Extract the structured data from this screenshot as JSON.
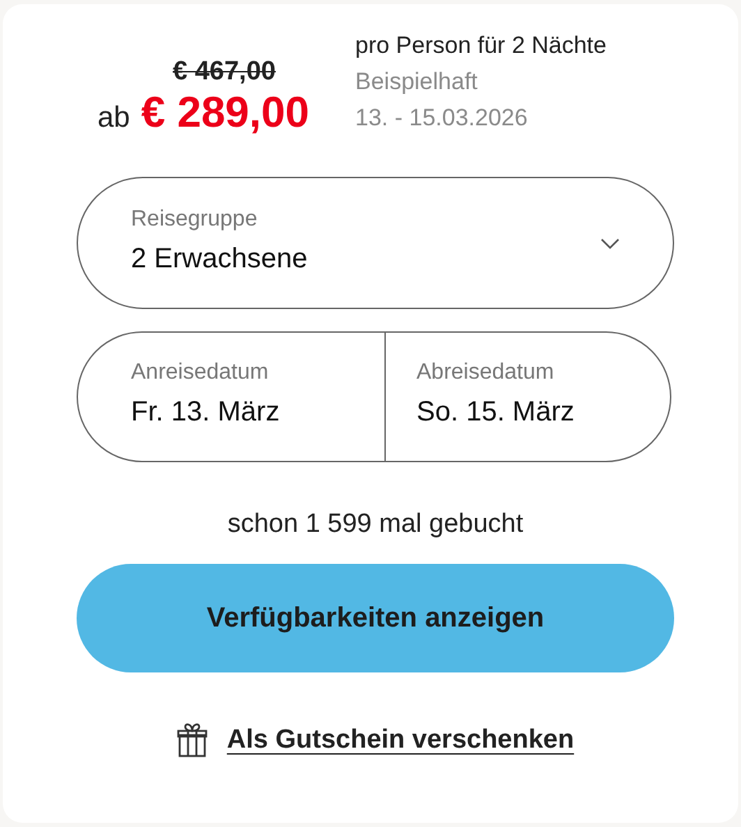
{
  "price": {
    "old": "€ 467,00",
    "prefix": "ab",
    "current": "€ 289,00",
    "per": "pro Person für 2 Nächte",
    "note": "Beispielhaft",
    "dates": "13. - 15.03.2026"
  },
  "group": {
    "label": "Reisegruppe",
    "value": "2 Erwachsene"
  },
  "dates": [
    {
      "label": "Anreisedatum",
      "value": "Fr. 13. März"
    },
    {
      "label": "Abreisedatum",
      "value": "So. 15. März"
    }
  ],
  "booked": "schon 1 599 mal gebucht",
  "cta": "Verfügbarkeiten anzeigen",
  "gift_link": "Als Gutschein verschenken"
}
